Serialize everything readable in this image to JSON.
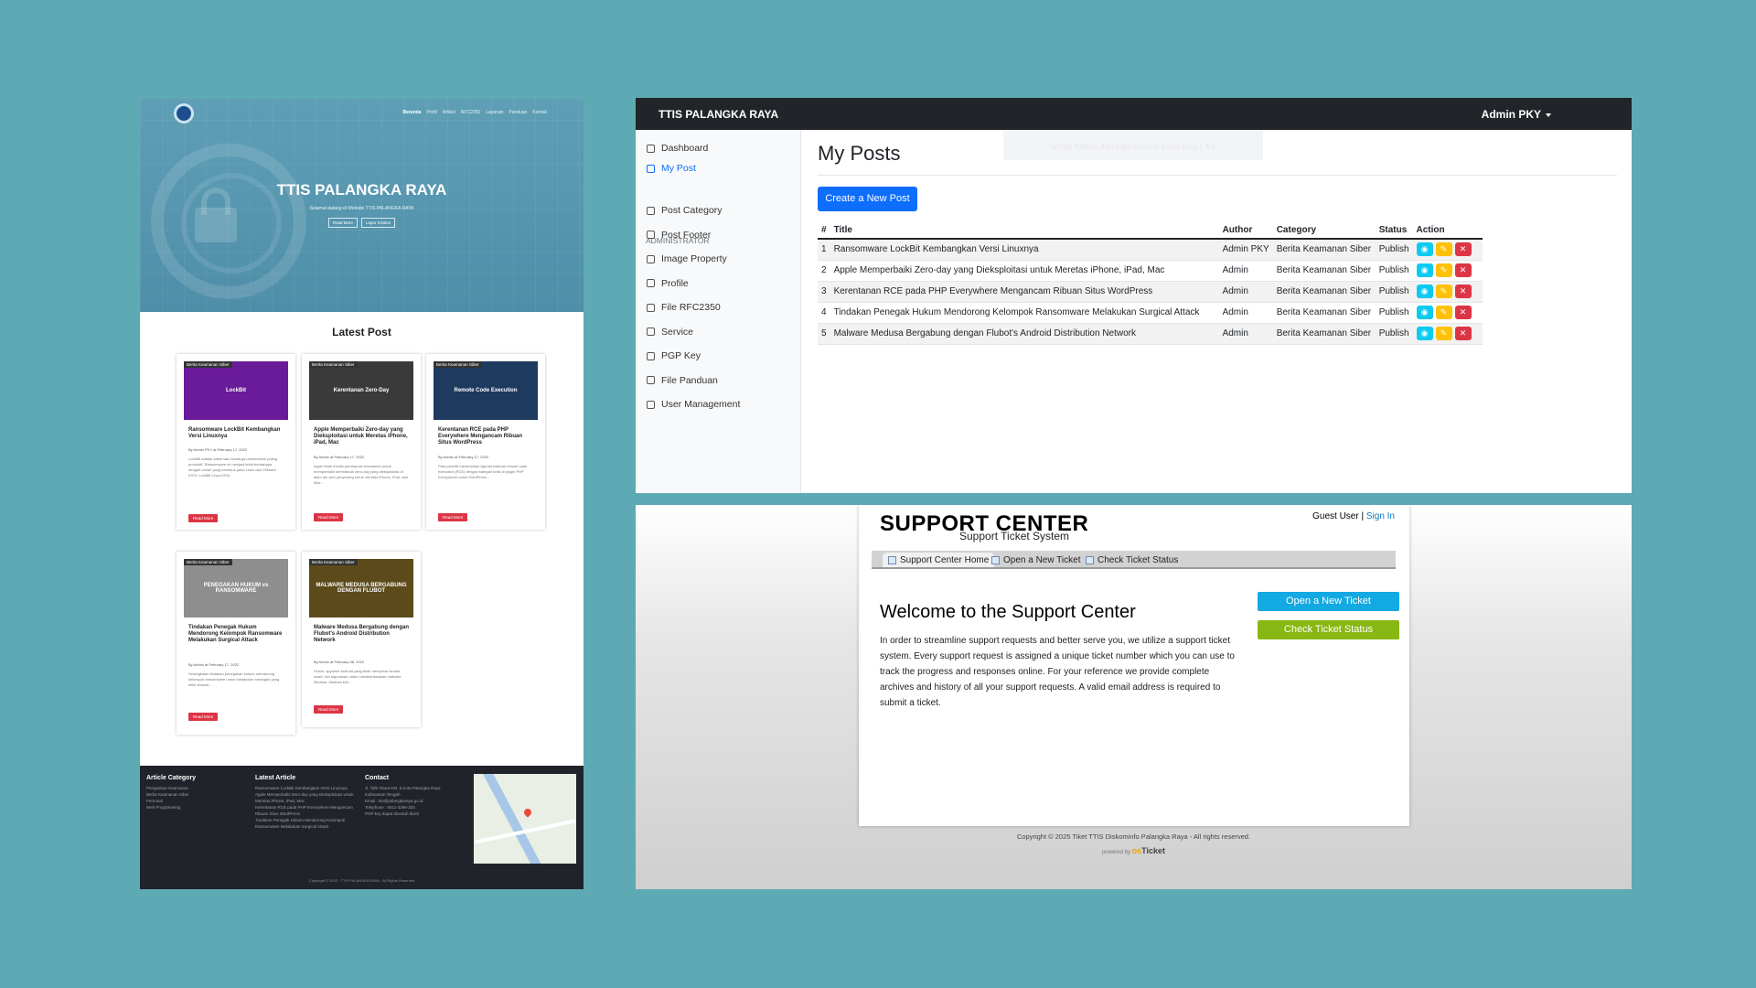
{
  "website": {
    "nav": [
      "Beranda",
      "Profil",
      "Artikel",
      "RFC2350",
      "Layanan",
      "Panduan",
      "Kontak"
    ],
    "hero_title": "TTIS PALANGKA RAYA",
    "hero_subtitle": "Selamat datang di Website TTIS PALANGKA RAYA",
    "hero_btn_read": "Read More",
    "hero_btn_report": "Lapor Insiden",
    "latest_title": "Latest Post",
    "read_more": "Read More",
    "cards": [
      {
        "tag": "Berita Keamanan Siber",
        "title": "Ransomware LockBit Kembangkan Versi Linuxnya",
        "meta": "By Admin PKY at February 17, 2022",
        "excerpt": "LockBit adalah salah satu keluarga ransomware paling produktif. Ransomware ini menjadi lebih berbahaya dengan varian yang berfokus pada Linux dan VMware ESXi, LockBit Linux-ESXi...",
        "thumb_text": "LockBit",
        "thumb_color": "#6a1b9a"
      },
      {
        "tag": "Berita Keamanan Siber",
        "title": "Apple Memperbaiki Zero-day yang Dieksploitasi untuk Meretas iPhone, iPad, Mac",
        "meta": "By Admin at February 17, 2022",
        "excerpt": "Apple telah merilis pembaruan keamanan untuk memperbaiki kerentanan zero-day yang dieksploitasi di alam liar oleh penyerang untuk meretas iPhone, iPad, dan Mac...",
        "thumb_text": "Kerentanan Zero-Day",
        "thumb_color": "#3a3a3a"
      },
      {
        "tag": "Berita Keamanan Siber",
        "title": "Kerentanan RCE pada PHP Everywhere Mengancam Ribuan Situs WordPress",
        "meta": "By Admin at February 17, 2022",
        "excerpt": "Para peneliti menemukan tiga kerentanan remote code execution (RCE) dengan kategori kritis di plugin PHP Everywhere untuk WordPress...",
        "thumb_text": "Remote Code Execution",
        "thumb_color": "#1e3a5f"
      },
      {
        "tag": "Berita Keamanan Siber",
        "title": "Tindakan Penegak Hukum Mendorong Kelompok Ransomware Melakukan Surgical Attack",
        "meta": "By Admin at February 17, 2022",
        "excerpt": "Serangkaian tindakan penegakan hukum mendorong kelompok ransomware untuk melakukan serangan yang lebih terarah...",
        "thumb_text": "PENEGAKAN HUKUM vs RANSOMWARE",
        "thumb_color": "#8e8e8e"
      },
      {
        "tag": "Berita Keamanan Siber",
        "title": "Malware Medusa Bergabung dengan Flubot's Android Distribution Network",
        "meta": "By Admin at February 08, 2022",
        "excerpt": "Flubot, spyware Android yang telah menyebar secara masif, kini digunakan untuk mendistribusikan malware Medusa. Medusa kini...",
        "thumb_text": "MALWARE MEDUSA BERGABUNG DENGAN FLUBOT",
        "thumb_color": "#5c4a1a"
      }
    ],
    "footer": {
      "col1_title": "Article Category",
      "col1_items": [
        "Pengaduan Keamanan",
        "Berita Keamanan Siber",
        "Personal",
        "Web Programming"
      ],
      "col2_title": "Latest Article",
      "col2_items": [
        "Ransomware LockBit Kembangkan Versi Linuxnya",
        "Apple Memperbaiki Zero-day yang Dieksploitasi untuk Meretas iPhone, iPad, Mac",
        "Kerentanan RCE pada PHP Everywhere Mengancam Ribuan Situs WordPress",
        "Tindakan Penegak Hukum Mendorong Kelompok Ransomware Melakukan Surgical Attack"
      ],
      "col3_title": "Contact",
      "col3_items": [
        "Jl. Tjilik Riwut KM. 5 Kota Palangka Raya",
        "Kalimantan Tengah",
        "Email : ttis@palangkaraya.go.id",
        "Telephone : 0511-3296-334",
        "PGP key dapat diunduh disini"
      ],
      "copyright": "Copyright © 2022 · TTIS PALANGKA RAYA · All Rights Reserved"
    }
  },
  "admin": {
    "brand": "TTIS PALANGKA RAYA",
    "user": "Admin PKY",
    "sidebar": {
      "main": [
        {
          "label": "Dashboard",
          "icon": "home-icon",
          "active": false
        },
        {
          "label": "My Post",
          "icon": "document-icon",
          "active": true
        }
      ],
      "heading": "ADMINISTRATOR",
      "admin_items": [
        {
          "label": "Post Category",
          "icon": "grid-icon"
        },
        {
          "label": "Post Footer",
          "icon": "layout-icon"
        },
        {
          "label": "Image Property",
          "icon": "image-icon"
        },
        {
          "label": "Profile",
          "icon": "clipboard-icon"
        },
        {
          "label": "File RFC2350",
          "icon": "file-icon"
        },
        {
          "label": "Service",
          "icon": "pin-icon"
        },
        {
          "label": "PGP Key",
          "icon": "key-icon"
        },
        {
          "label": "File Panduan",
          "icon": "book-icon"
        },
        {
          "label": "User Management",
          "icon": "users-icon"
        }
      ]
    },
    "page_title": "My Posts",
    "toast_text": "Untuk Admin dan juga pemilik pada blog | 4.x",
    "new_post_btn": "Create a New Post",
    "table": {
      "headers": [
        "#",
        "Title",
        "Author",
        "Category",
        "Status",
        "Action"
      ],
      "rows": [
        [
          "1",
          "Ransomware LockBit Kembangkan Versi Linuxnya",
          "Admin PKY",
          "Berita Keamanan Siber",
          "Publish"
        ],
        [
          "2",
          "Apple Memperbaiki Zero-day yang Dieksploitasi untuk Meretas iPhone, iPad, Mac",
          "Admin",
          "Berita Keamanan Siber",
          "Publish"
        ],
        [
          "3",
          "Kerentanan RCE pada PHP Everywhere Mengancam Ribuan Situs WordPress",
          "Admin",
          "Berita Keamanan Siber",
          "Publish"
        ],
        [
          "4",
          "Tindakan Penegak Hukum Mendorong Kelompok Ransomware Melakukan Surgical Attack",
          "Admin",
          "Berita Keamanan Siber",
          "Publish"
        ],
        [
          "5",
          "Malware Medusa Bergabung dengan Flubot's Android Distribution Network",
          "Admin",
          "Berita Keamanan Siber",
          "Publish"
        ]
      ]
    }
  },
  "support": {
    "title": "SUPPORT CENTER",
    "subtitle": "Support Ticket System",
    "guest": "Guest User | ",
    "sign_in": "Sign In",
    "tabs": [
      "Support Center Home",
      "Open a New Ticket",
      "Check Ticket Status"
    ],
    "welcome": "Welcome to the Support Center",
    "body": "In order to streamline support requests and better serve you, we utilize a support ticket system. Every support request is assigned a unique ticket number which you can use to track the progress and responses online. For your reference we provide complete archives and history of all your support requests. A valid email address is required to submit a ticket.",
    "btn_open": "Open a New Ticket",
    "btn_check": "Check Ticket Status",
    "copyright": "Copyright © 2025 Tiket TTIS Diskominfo Palangka Raya - All rights reserved.",
    "powered": "powered by",
    "powered_brand_a": "os",
    "powered_brand_b": "Ticket"
  }
}
